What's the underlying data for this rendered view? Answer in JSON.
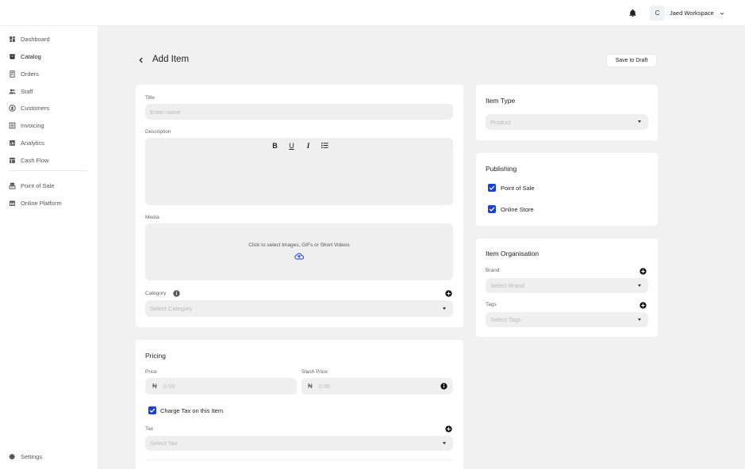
{
  "header": {
    "avatar_initial": "C",
    "workspace_name": "Jaed Workspace"
  },
  "sidebar": {
    "items": [
      {
        "label": "Dashboard",
        "icon": "dashboard-icon"
      },
      {
        "label": "Catalog",
        "icon": "catalog-icon",
        "active": true
      },
      {
        "label": "Orders",
        "icon": "orders-icon"
      },
      {
        "label": "Staff",
        "icon": "staff-icon"
      },
      {
        "label": "Customers",
        "icon": "customers-icon"
      },
      {
        "label": "Invoicing",
        "icon": "invoicing-icon"
      },
      {
        "label": "Analytics",
        "icon": "analytics-icon"
      },
      {
        "label": "Cash Flow",
        "icon": "cash-flow-icon"
      }
    ],
    "channels": [
      {
        "label": "Point of Sale",
        "icon": "point-of-sale-icon"
      },
      {
        "label": "Online Platform",
        "icon": "online-platform-icon"
      }
    ],
    "settings_label": "Settings"
  },
  "page": {
    "title": "Add Item",
    "save_draft_label": "Save to Draft"
  },
  "details": {
    "title_label": "Title",
    "title_placeholder": "Enter name",
    "description_label": "Description",
    "media_label": "Media",
    "media_hint": "Click to select Images, GIFs or Short Videos",
    "category_label": "Category",
    "category_placeholder": "Select Category"
  },
  "pricing": {
    "heading": "Pricing",
    "price_label": "Price",
    "price_currency": "₦",
    "price_placeholder": "0.00",
    "slash_label": "Slash Price",
    "slash_currency": "₦",
    "slash_placeholder": "0.00",
    "charge_tax_label": "Charge Tax on this Item",
    "charge_tax_checked": true,
    "tax_label": "Tax",
    "tax_placeholder": "Select Tax"
  },
  "item_type": {
    "heading": "Item Type",
    "selected": "Product"
  },
  "publishing": {
    "heading": "Publishing",
    "options": [
      {
        "label": "Point of Sale",
        "checked": true
      },
      {
        "label": "Online Store",
        "checked": true
      }
    ]
  },
  "organisation": {
    "heading": "Item Organisation",
    "brand_label": "Brand",
    "brand_placeholder": "Select Brand",
    "tags_label": "Tags",
    "tags_placeholder": "Select Tags"
  },
  "colors": {
    "accent_checkbox": "#1a3fd6",
    "field_bg": "#efefef",
    "page_bg": "#f1f1f1"
  }
}
